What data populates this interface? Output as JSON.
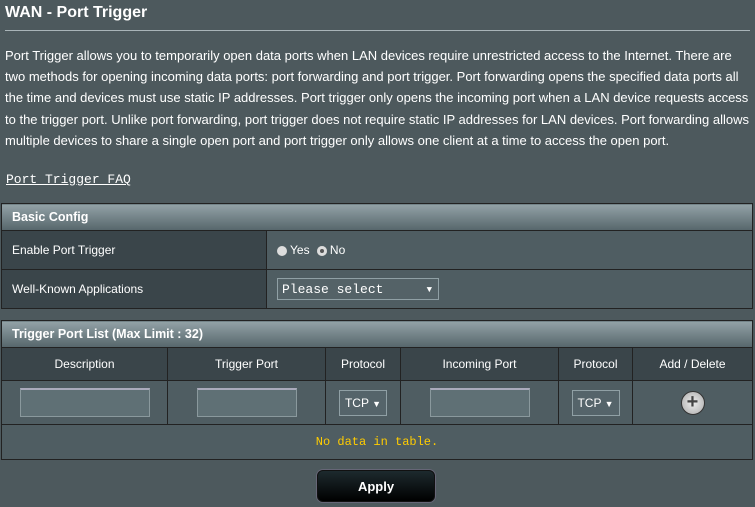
{
  "title": "WAN - Port Trigger",
  "description": "Port Trigger allows you to temporarily open data ports when LAN devices require unrestricted access to the Internet. There are two methods for opening incoming data ports: port forwarding and port trigger. Port forwarding opens the specified data ports all the time and devices must use static IP addresses. Port trigger only opens the incoming port when a LAN device requests access to the trigger port. Unlike port forwarding, port trigger does not require static IP addresses for LAN devices. Port forwarding allows multiple devices to share a single open port and port trigger only allows one client at a time to access the open port.",
  "faq_link": "Port Trigger FAQ",
  "basic": {
    "header": "Basic Config",
    "enable_label": "Enable Port Trigger",
    "yes": "Yes",
    "no": "No",
    "selected": "No",
    "apps_label": "Well-Known Applications",
    "apps_value": "Please select"
  },
  "list": {
    "header": "Trigger Port List (Max Limit : 32)",
    "columns": [
      "Description",
      "Trigger Port",
      "Protocol",
      "Incoming Port",
      "Protocol",
      "Add / Delete"
    ],
    "trigger_protocol": "TCP",
    "incoming_protocol": "TCP",
    "empty": "No data in table."
  },
  "apply": "Apply"
}
